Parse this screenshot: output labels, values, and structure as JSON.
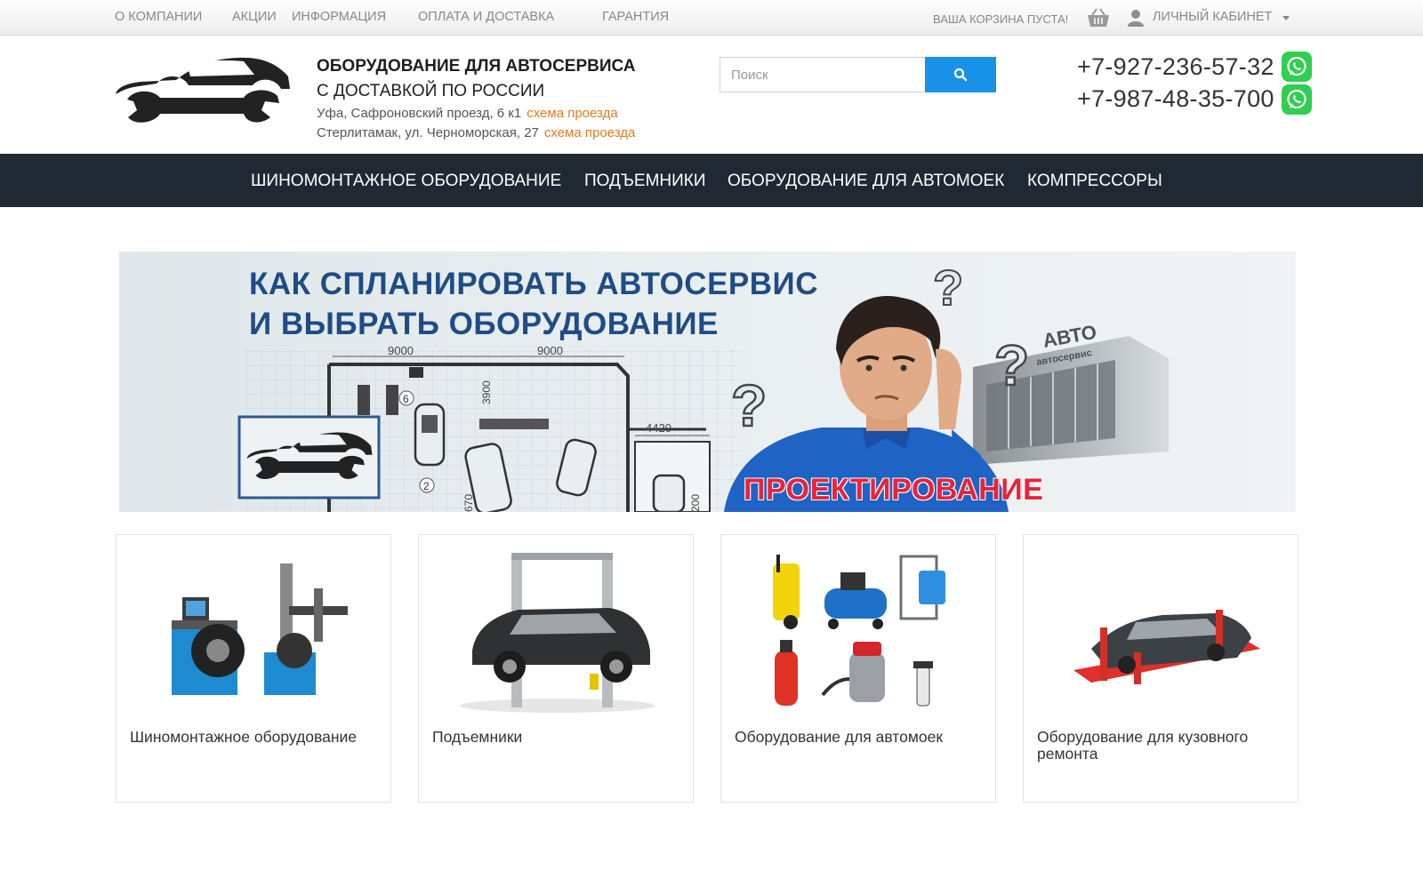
{
  "topbar": {
    "links": [
      "О компании",
      "Акции",
      "Информация",
      "Оплата и доставка",
      "Гарантия"
    ],
    "cart_text": "ВАША КОРЗИНА ПУСТА!",
    "account_label": "ЛИЧНЫЙ КАБИНЕТ"
  },
  "header": {
    "brand_line1": "ОБОРУДОВАНИЕ ДЛЯ АВТОСЕРВИСА",
    "brand_line2": "С ДОСТАВКОЙ ПО РОССИИ",
    "addresses": [
      {
        "text": "Уфа, Сафроновский проезд, 6 к1",
        "link": "схема проезда"
      },
      {
        "text": "Стерлитамак, ул. Черноморская, 27",
        "link": "схема проезда"
      }
    ],
    "search_placeholder": "Поиск",
    "phones": [
      "+7-927-236-57-32",
      "+7-987-48-35-700"
    ]
  },
  "nav": {
    "items": [
      "Шиномонтажное оборудование",
      "Подъемники",
      "Оборудование для автомоек",
      "Компрессоры"
    ]
  },
  "banner": {
    "title_line1": "КАК СПЛАНИРОВАТЬ АВТОСЕРВИС",
    "title_line2": "И ВЫБРАТЬ ОБОРУДОВАНИЕ",
    "tag": "ПРОЕКТИРОВАНИЕ",
    "dimensions": [
      "9000",
      "9000",
      "3900",
      "4420",
      "670",
      "200"
    ],
    "plan_numbers": [
      "6",
      "2"
    ],
    "building_sign": "АВТО",
    "building_sign2": "автосервис"
  },
  "categories": [
    {
      "title": "Шиномонтажное оборудование",
      "icon": "tire-equipment-image"
    },
    {
      "title": "Подъемники",
      "icon": "car-lift-image"
    },
    {
      "title": "Оборудование для автомоек",
      "icon": "car-wash-equipment-image"
    },
    {
      "title": "Оборудование для кузовного ремонта",
      "icon": "body-repair-equipment-image"
    }
  ],
  "colors": {
    "nav_bg": "#1f2833",
    "accent_blue": "#1a91e8",
    "link_orange": "#e07a1f",
    "whatsapp_green": "#2fcf4f",
    "banner_title": "#1f4c86",
    "banner_tag": "#e8243a"
  }
}
